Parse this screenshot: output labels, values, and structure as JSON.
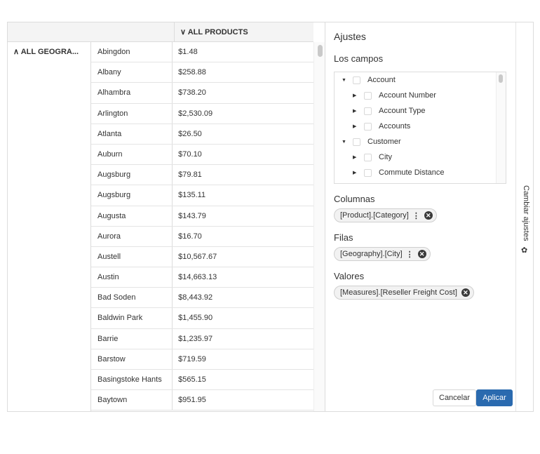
{
  "grid": {
    "column_header": "ALL PRODUCTS",
    "column_chevron": "∨",
    "row_header": "ALL GEOGRA...",
    "row_chevron": "∧",
    "rows": [
      {
        "city": "Abingdon",
        "value": "$1.48"
      },
      {
        "city": "Albany",
        "value": "$258.88"
      },
      {
        "city": "Alhambra",
        "value": "$738.20"
      },
      {
        "city": "Arlington",
        "value": "$2,530.09"
      },
      {
        "city": "Atlanta",
        "value": "$26.50"
      },
      {
        "city": "Auburn",
        "value": "$70.10"
      },
      {
        "city": "Augsburg",
        "value": "$79.81"
      },
      {
        "city": "Augsburg",
        "value": "$135.11"
      },
      {
        "city": "Augusta",
        "value": "$143.79"
      },
      {
        "city": "Aurora",
        "value": "$16.70"
      },
      {
        "city": "Austell",
        "value": "$10,567.67"
      },
      {
        "city": "Austin",
        "value": "$14,663.13"
      },
      {
        "city": "Bad Soden",
        "value": "$8,443.92"
      },
      {
        "city": "Baldwin Park",
        "value": "$1,455.90"
      },
      {
        "city": "Barrie",
        "value": "$1,235.97"
      },
      {
        "city": "Barstow",
        "value": "$719.59"
      },
      {
        "city": "Basingstoke Hants",
        "value": "$565.15"
      },
      {
        "city": "Baytown",
        "value": "$951.95"
      }
    ]
  },
  "settings": {
    "title": "Ajustes",
    "fields_title": "Los campos",
    "tree": [
      {
        "label": "Account",
        "level": 0,
        "expanded": true
      },
      {
        "label": "Account Number",
        "level": 1,
        "expanded": false
      },
      {
        "label": "Account Type",
        "level": 1,
        "expanded": false
      },
      {
        "label": "Accounts",
        "level": 1,
        "expanded": false
      },
      {
        "label": "Customer",
        "level": 0,
        "expanded": true
      },
      {
        "label": "City",
        "level": 1,
        "expanded": false
      },
      {
        "label": "Commute Distance",
        "level": 1,
        "expanded": false
      }
    ],
    "columns_title": "Columnas",
    "columns_chip": "[Product].[Category]",
    "rows_title": "Filas",
    "rows_chip": "[Geography].[City]",
    "values_title": "Valores",
    "values_chip": "[Measures].[Reseller Freight Cost]",
    "cancel_label": "Cancelar",
    "apply_label": "Aplicar",
    "chip_remove_glyph": "✕",
    "chip_menu_glyph": "⋮"
  },
  "toggle": {
    "label": "Cambiar ajustes",
    "icon": "gear-icon",
    "glyph": "✿"
  }
}
